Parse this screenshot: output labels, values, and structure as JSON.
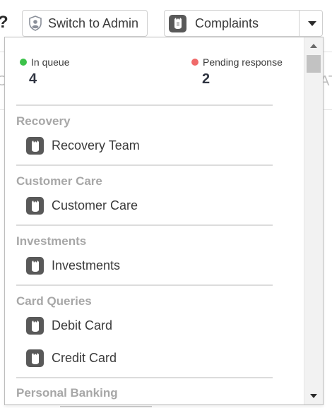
{
  "background": {
    "help_glyph": "?",
    "left_fragment": "O",
    "right_fragment": "AT"
  },
  "toolbar": {
    "admin_button_label": "Switch to Admin",
    "queue_select_value": "Complaints"
  },
  "stats": {
    "in_queue": {
      "label": "In queue",
      "count": "4",
      "color": "#3cc24a"
    },
    "pending": {
      "label": "Pending response",
      "count": "2",
      "color": "#f06a6a"
    }
  },
  "groups": [
    {
      "title": "Recovery",
      "items": [
        {
          "label": "Recovery Team",
          "icon": "queue-icon"
        }
      ]
    },
    {
      "title": "Customer Care",
      "items": [
        {
          "label": "Customer Care",
          "icon": "queue-icon"
        }
      ]
    },
    {
      "title": "Investments",
      "items": [
        {
          "label": "Investments",
          "icon": "queue-icon"
        }
      ]
    },
    {
      "title": "Card Queries",
      "items": [
        {
          "label": "Debit Card",
          "icon": "queue-icon"
        },
        {
          "label": "Credit Card",
          "icon": "queue-icon"
        }
      ]
    },
    {
      "title": "Personal Banking",
      "items": []
    }
  ]
}
